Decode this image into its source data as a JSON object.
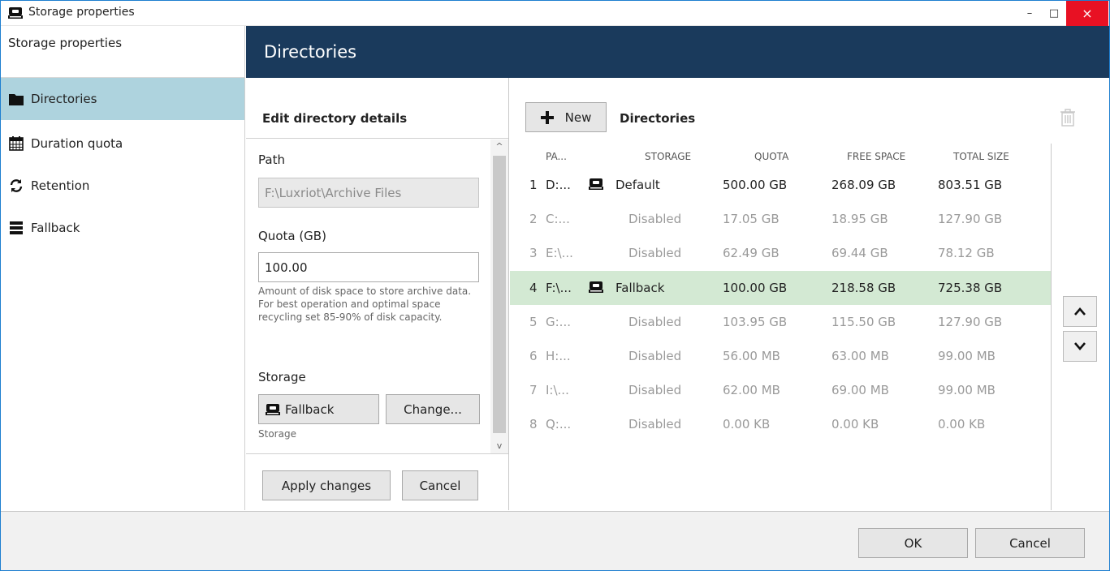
{
  "window": {
    "title": "Storage properties",
    "controls": {
      "minimize": "–",
      "maximize": "□",
      "close": "×"
    }
  },
  "sidebar": {
    "header": "Storage properties",
    "items": [
      {
        "label": "Directories",
        "icon": "folder-icon",
        "active": true
      },
      {
        "label": "Duration quota",
        "icon": "calendar-icon",
        "active": false
      },
      {
        "label": "Retention",
        "icon": "refresh-icon",
        "active": false
      },
      {
        "label": "Fallback",
        "icon": "server-icon",
        "active": false
      }
    ]
  },
  "header": {
    "title": "Directories"
  },
  "edit": {
    "heading": "Edit directory details",
    "path_label": "Path",
    "path_value": "F:\\Luxriot\\Archive Files",
    "quota_label": "Quota (GB)",
    "quota_value": "100.00",
    "quota_hint": "Amount of disk space to store archive data. For best operation and optimal space recycling set 85-90% of disk capacity.",
    "storage_label": "Storage",
    "storage_value": "Fallback",
    "change_button": "Change...",
    "storage_hint": "Storage",
    "apply_button": "Apply changes",
    "cancel_button": "Cancel"
  },
  "directories": {
    "new_button": "New",
    "title": "Directories",
    "columns": [
      "PA...",
      "STORAGE",
      "QUOTA",
      "FREE SPACE",
      "TOTAL SIZE"
    ],
    "rows": [
      {
        "num": "1",
        "path": "D:...",
        "storage": "Default",
        "quota": "500.00 GB",
        "free": "268.09 GB",
        "total": "803.51 GB",
        "has_icon": true
      },
      {
        "num": "2",
        "path": "C:...",
        "storage": "Disabled",
        "quota": "17.05 GB",
        "free": "18.95 GB",
        "total": "127.90 GB",
        "has_icon": false
      },
      {
        "num": "3",
        "path": "E:\\...",
        "storage": "Disabled",
        "quota": "62.49 GB",
        "free": "69.44 GB",
        "total": "78.12 GB",
        "has_icon": false
      },
      {
        "num": "4",
        "path": "F:\\...",
        "storage": "Fallback",
        "quota": "100.00 GB",
        "free": "218.58 GB",
        "total": "725.38 GB",
        "has_icon": true
      },
      {
        "num": "5",
        "path": "G:...",
        "storage": "Disabled",
        "quota": "103.95 GB",
        "free": "115.50 GB",
        "total": "127.90 GB",
        "has_icon": false
      },
      {
        "num": "6",
        "path": "H:...",
        "storage": "Disabled",
        "quota": "56.00 MB",
        "free": "63.00 MB",
        "total": "99.00 MB",
        "has_icon": false
      },
      {
        "num": "7",
        "path": "I:\\...",
        "storage": "Disabled",
        "quota": "62.00 MB",
        "free": "69.00 MB",
        "total": "99.00 MB",
        "has_icon": false
      },
      {
        "num": "8",
        "path": "Q:...",
        "storage": "Disabled",
        "quota": "0.00 KB",
        "free": "0.00 KB",
        "total": "0.00 KB",
        "has_icon": false
      }
    ]
  },
  "footer": {
    "ok_button": "OK",
    "cancel_button": "Cancel"
  },
  "colors": {
    "header_band": "#1a3a5c",
    "nav_active": "#aed3de",
    "row_selected": "#d3e9d3",
    "close_button": "#e81123"
  }
}
